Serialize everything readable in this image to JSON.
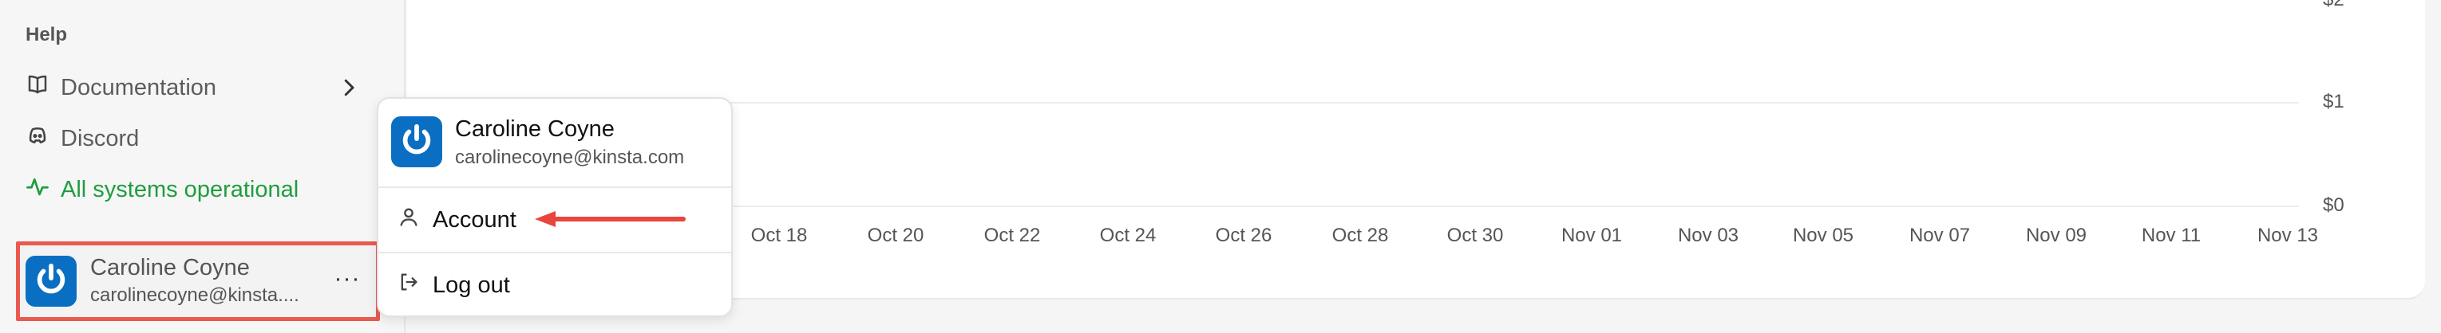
{
  "sidebar": {
    "section_label": "Help",
    "items": [
      {
        "label": "Documentation",
        "icon": "book-icon"
      },
      {
        "label": "Discord",
        "icon": "discord-icon"
      },
      {
        "label": "All systems operational",
        "icon": "activity-icon",
        "color": "#1f9d3f"
      }
    ]
  },
  "user": {
    "name": "Caroline Coyne",
    "email_truncated": "carolinecoyne@kinsta....",
    "email": "carolinecoyne@kinsta.com",
    "more_label": "···"
  },
  "menu": {
    "account_label": "Account",
    "logout_label": "Log out"
  },
  "chart": {
    "y_labels": [
      "$2",
      "$1",
      "$0"
    ],
    "x_labels": [
      "Oct 18",
      "Oct 20",
      "Oct 22",
      "Oct 24",
      "Oct 26",
      "Oct 28",
      "Oct 30",
      "Nov 01",
      "Nov 03",
      "Nov 05",
      "Nov 07",
      "Nov 09",
      "Nov 11",
      "Nov 13"
    ]
  },
  "colors": {
    "highlight": "#ea5a4f",
    "brand": "#0a6fc2",
    "status": "#1f9d3f"
  }
}
